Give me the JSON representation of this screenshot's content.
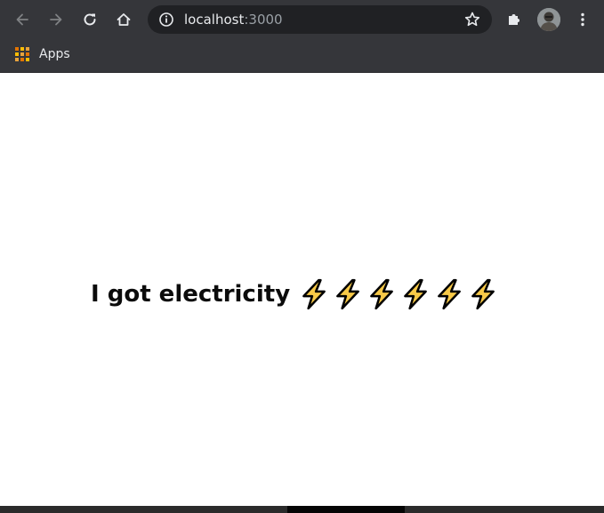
{
  "browser": {
    "address_bar": {
      "host": "localhost",
      "port": ":3000"
    },
    "toolbar_icons": {
      "back": "back-arrow-icon",
      "forward": "forward-arrow-icon",
      "reload": "reload-icon",
      "home": "home-icon",
      "site_info": "info-icon",
      "bookmark_star": "star-icon",
      "extensions": "puzzle-icon",
      "profile": "avatar",
      "menu": "kebab-menu-icon"
    },
    "bookmarks_bar": {
      "apps_label": "Apps",
      "apps_icon": "apps-grid-icon"
    }
  },
  "page": {
    "headline": "I got electricity",
    "bolt_count": 6,
    "bolt_icon": "lightning-bolt-icon"
  },
  "colors": {
    "chrome_dark": "#35363a",
    "omnibox": "#202124",
    "text_light": "#e8eaed",
    "bolt_fill": "#f7c948",
    "bolt_outline": "#000000"
  }
}
